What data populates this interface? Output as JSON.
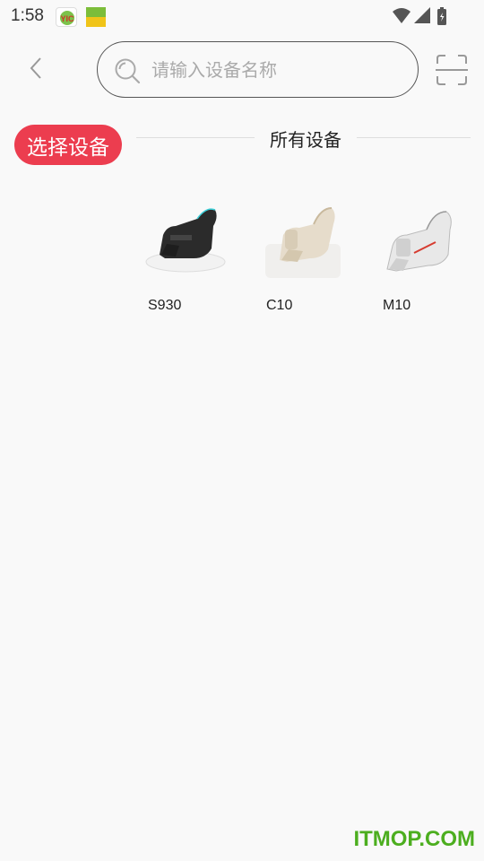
{
  "status_bar": {
    "time": "1:58",
    "app_icon_1_label": "YIC",
    "app_icon_2_label": "",
    "icons": [
      "wifi-icon",
      "signal-icon",
      "battery-icon"
    ]
  },
  "header": {
    "back_icon": "chevron-left-icon",
    "search": {
      "placeholder": "请输入设备名称",
      "value": ""
    },
    "scan_icon": "scan-icon"
  },
  "section": {
    "select_label": "选择设备",
    "title": "所有设备"
  },
  "devices": [
    {
      "name": "S930",
      "color": "#2b2b2b",
      "accent": "#3ccfd8"
    },
    {
      "name": "C10",
      "color": "#e6dccb",
      "accent": "#c9b99d"
    },
    {
      "name": "M10",
      "color": "#e8e8e8",
      "accent": "#d63b2f"
    }
  ],
  "colors": {
    "accent_red": "#ec3d4f",
    "watermark_green": "#4cae1f"
  },
  "watermark": "ITMOP.COM"
}
